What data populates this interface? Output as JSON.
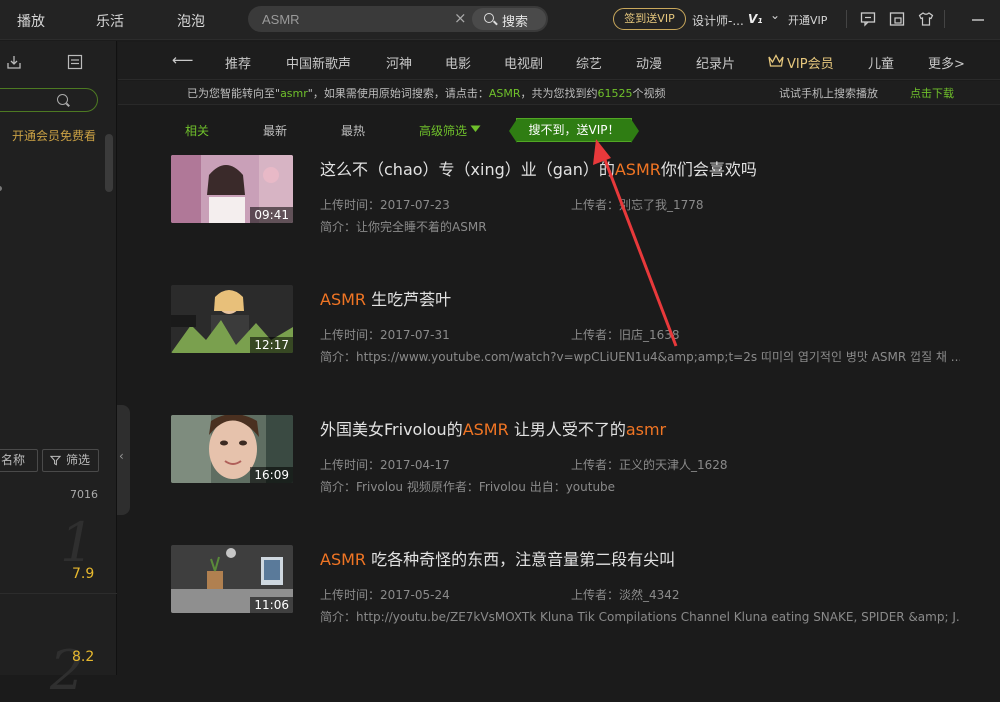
{
  "topbar": {
    "nav": [
      "播放",
      "乐活",
      "泡泡"
    ],
    "search": {
      "value": "ASMR",
      "clear": "×",
      "button": "搜索"
    },
    "checkin": "签到送VIP",
    "user": "设计师-...",
    "vip_level": "V₁",
    "chevron": "⌄",
    "open_vip": "开通VIP",
    "icons": [
      "message-icon",
      "miniplayer-icon",
      "skin-icon",
      "minimize-icon"
    ]
  },
  "left": {
    "vip_free": "开通会员免费看",
    "sort_name": "名称",
    "filter": "筛选",
    "count": "7016",
    "ranks": [
      {
        "rank": "1",
        "score": "7.9"
      },
      {
        "rank": "2",
        "score": "8.2"
      }
    ]
  },
  "catnav": {
    "back": "⟵",
    "items": [
      "推荐",
      "中国新歌声",
      "河神",
      "电影",
      "电视剧",
      "综艺",
      "动漫",
      "纪录片",
      "VIP会员",
      "儿童",
      "更多>"
    ]
  },
  "notice": {
    "p1": "已为您智能转向至\"",
    "term": "asmr",
    "p2": "\"，如果需使用原始词搜索，请点击：",
    "orig": "ASMR",
    "p3": "，共为您找到约",
    "count": "61525",
    "p4": "个视频",
    "mobile": "试试手机上搜索播放",
    "download": "点击下载"
  },
  "filters": {
    "related": "相关",
    "latest": "最新",
    "hottest": "最热",
    "advanced": "高级筛选",
    "promo": "搜不到，送VIP！"
  },
  "labels": {
    "uploaded": "上传时间：",
    "uploader": "上传者：",
    "intro": "简介："
  },
  "results": [
    {
      "title_parts": [
        "这么不（chao）专（xing）业（gan）的",
        "ASMR",
        "你们会喜欢吗"
      ],
      "duration": "09:41",
      "date": "2017-07-23",
      "uploader": "别忘了我_1778",
      "desc": "让你完全睡不着的ASMR"
    },
    {
      "title_parts": [
        "",
        "ASMR",
        " 生吃芦荟叶"
      ],
      "duration": "12:17",
      "date": "2017-07-31",
      "uploader": "旧店_1638",
      "desc": "https://www.youtube.com/watch?v=wpCLiUEN1u4&amp;amp;t=2s 띠미의 엽기적인 병맛 ASMR 껍질 채 ..."
    },
    {
      "title_parts": [
        "外国美女Frivolou的",
        "ASMR",
        " 让男人受不了的",
        "asmr"
      ],
      "duration": "16:09",
      "date": "2017-04-17",
      "uploader": "正义的天津人_1628",
      "desc": "Frivolou 视频原作者：Frivolou 出自：youtube"
    },
    {
      "title_parts": [
        "",
        "ASMR",
        " 吃各种奇怪的东西，注意音量第二段有尖叫"
      ],
      "duration": "11:06",
      "date": "2017-05-24",
      "uploader": "淡然_4342",
      "desc": "http://youtu.be/ZE7kVsMOXTk Kluna Tik Compilations Channel  Kluna eating SNAKE, SPIDER &amp; J..."
    }
  ],
  "colors": {
    "accent": "#6fc02b",
    "highlight": "#f07524",
    "gold": "#e8b92e",
    "annotation": "#e8393b"
  }
}
